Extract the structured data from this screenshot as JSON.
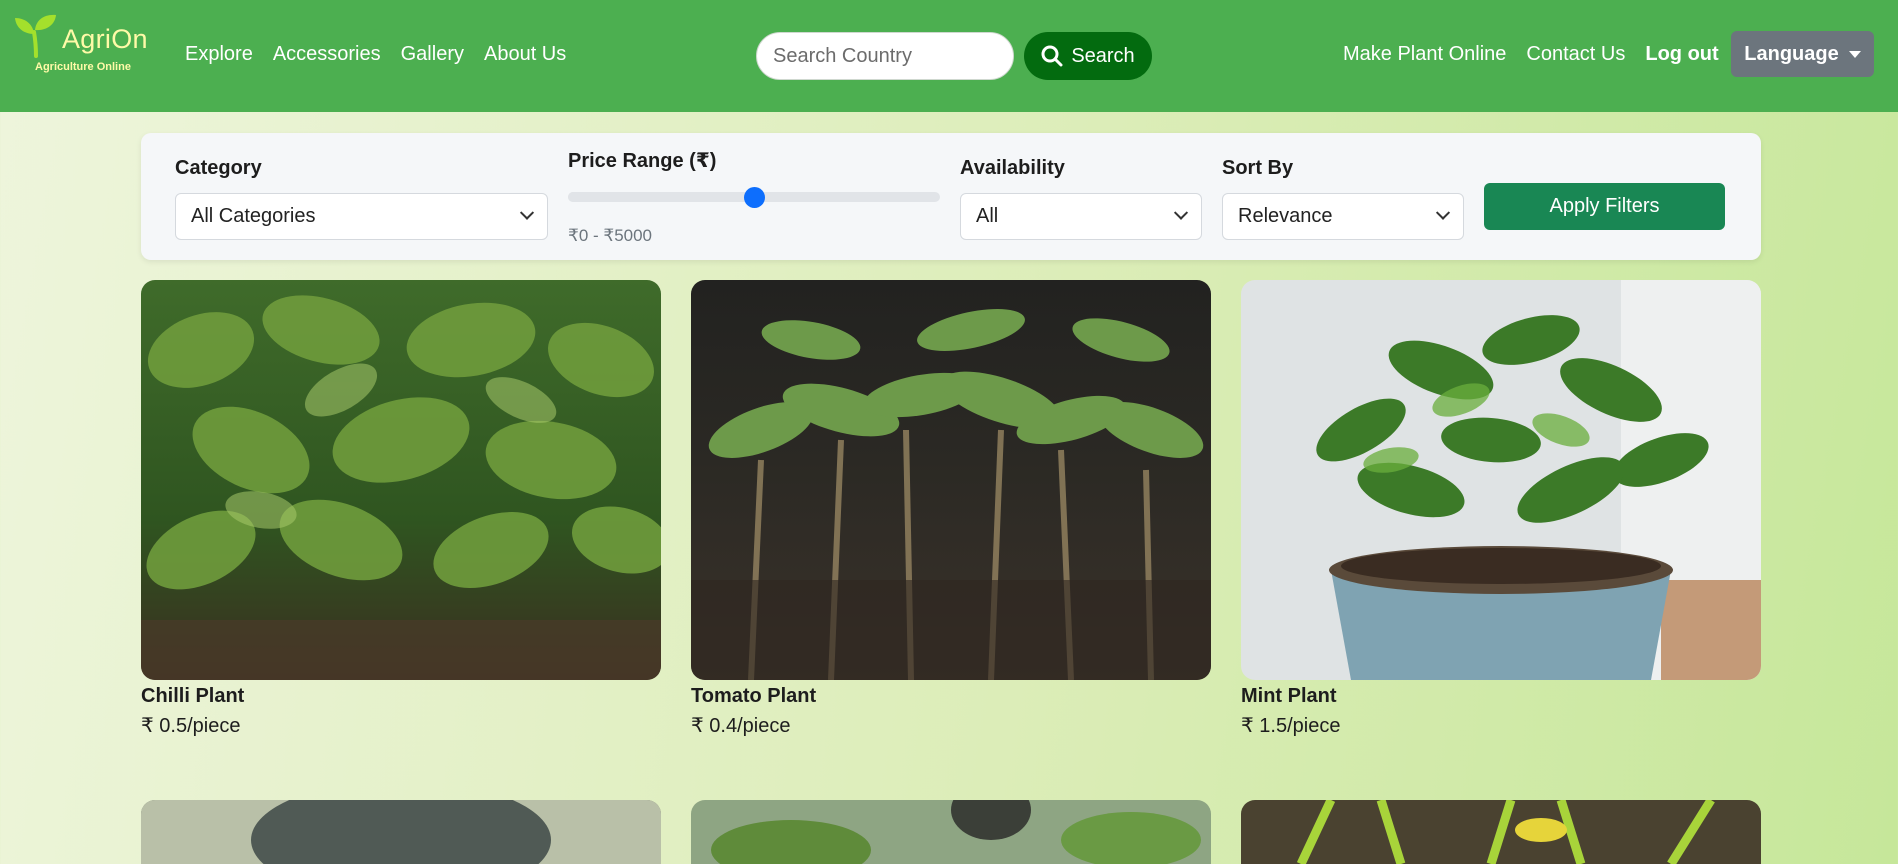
{
  "brand": {
    "name": "AgriOn",
    "tagline": "Agriculture Online"
  },
  "nav": {
    "left": [
      "Explore",
      "Accessories",
      "Gallery",
      "About Us"
    ],
    "right": [
      "Make Plant Online",
      "Contact Us",
      "Log out"
    ]
  },
  "search": {
    "placeholder": "Search Country",
    "value": "",
    "button_label": "Search"
  },
  "language": {
    "label": "Language"
  },
  "filters": {
    "category": {
      "label": "Category",
      "value": "All Categories"
    },
    "price": {
      "label": "Price Range (₹)",
      "min": 0,
      "max": 5000,
      "value": 2500,
      "range_text": "₹0 - ₹5000"
    },
    "availability": {
      "label": "Availability",
      "value": "All"
    },
    "sort": {
      "label": "Sort By",
      "value": "Relevance"
    },
    "apply_label": "Apply Filters"
  },
  "products": [
    {
      "name": "Chilli Plant",
      "price": "₹ 0.5/piece"
    },
    {
      "name": "Tomato Plant",
      "price": "₹ 0.4/piece"
    },
    {
      "name": "Mint Plant",
      "price": "₹ 1.5/piece"
    }
  ],
  "colors": {
    "navbar": "#4caf50",
    "brand_text": "#fffaa8",
    "search_button": "#036b0f",
    "language_button": "#6c757d",
    "apply_button": "#198754",
    "slider_thumb": "#0d6efd"
  },
  "icons": {
    "logo": "sprout-icon",
    "search": "search-icon",
    "dropdown": "chevron-down-icon",
    "language": "caret-down-icon"
  }
}
